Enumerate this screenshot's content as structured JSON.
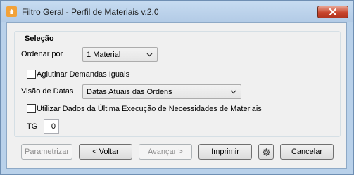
{
  "window": {
    "title": "Filtro Geral - Perfil de Materiais v.2.0"
  },
  "group": {
    "legend": "Seleção"
  },
  "fields": {
    "order_label": "Ordenar por",
    "order_value": "1 Material",
    "aggregate_label": "Aglutinar Demandas Iguais",
    "aggregate_checked": false,
    "dates_label": "Visão de Datas",
    "dates_value": "Datas Atuais das Ordens",
    "last_run_label": "Utilizar Dados da Última Execução de Necessidades de Materiais",
    "last_run_checked": false,
    "tg_label": "TG",
    "tg_value": "0"
  },
  "buttons": {
    "parametrizar": "Parametrizar",
    "voltar": "< Voltar",
    "avancar": "Avançar >",
    "imprimir": "Imprimir",
    "cancelar": "Cancelar"
  },
  "icons": {
    "app": "app-icon",
    "close": "close-icon",
    "settings": "gear-icon"
  }
}
